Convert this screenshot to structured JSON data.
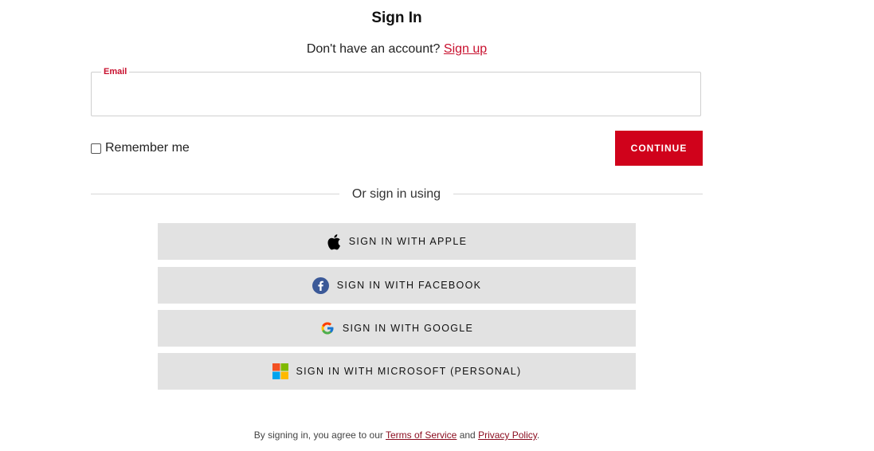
{
  "header": {
    "title": "Sign In",
    "no_account_text": "Don't have an account?",
    "signup_link": "Sign up"
  },
  "form": {
    "email_label": "Email",
    "email_value": "",
    "remember_label": "Remember me",
    "remember_checked": false,
    "continue_label": "CONTINUE"
  },
  "divider": {
    "text": "Or sign in using"
  },
  "sso": {
    "apple": "SIGN IN WITH APPLE",
    "facebook": "SIGN IN WITH FACEBOOK",
    "google": "SIGN IN WITH GOOGLE",
    "microsoft": "SIGN IN WITH MICROSOFT (PERSONAL)"
  },
  "legal": {
    "prefix": "By signing in, you agree to our",
    "terms": "Terms of Service",
    "and": "and",
    "privacy": "Privacy Policy",
    "suffix": "."
  },
  "colors": {
    "accent": "#d0021b",
    "button_bg": "#e2e2e2",
    "facebook": "#3b5998"
  },
  "icons": {
    "apple": "apple-icon",
    "facebook": "facebook-icon",
    "google": "google-icon",
    "microsoft": "microsoft-icon"
  }
}
